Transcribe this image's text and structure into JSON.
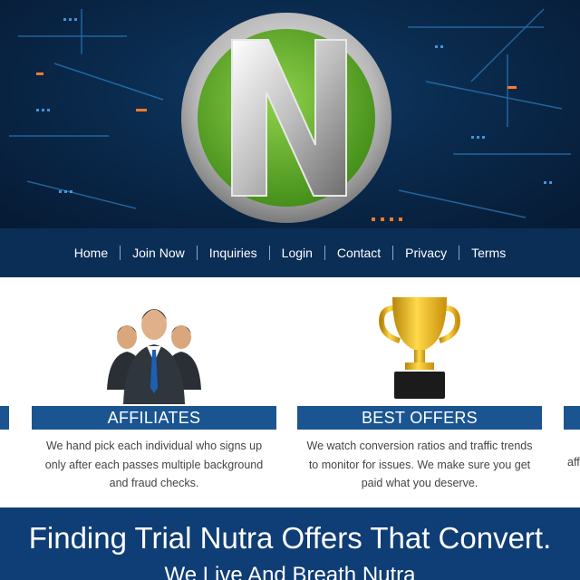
{
  "colors": {
    "header_bg": "#0a2a4d",
    "nav_bg": "#0b2e57",
    "ribbon": "#1a5591",
    "tagline_bg": "#0f3d75",
    "logo_green": "#6ab22e"
  },
  "logo": {
    "letter": "N",
    "icon": "nutra-n-logo"
  },
  "nav": {
    "items": [
      {
        "label": "Home"
      },
      {
        "label": "Join Now"
      },
      {
        "label": "Inquiries"
      },
      {
        "label": "Login"
      },
      {
        "label": "Contact"
      },
      {
        "label": "Privacy"
      },
      {
        "label": "Terms"
      }
    ]
  },
  "features": [
    {
      "title": "AFFILIATES",
      "icon": "business-team-icon",
      "lines": [
        "We hand pick each individual who signs up",
        "only after each passes multiple background",
        "and fraud checks."
      ]
    },
    {
      "title": "BEST OFFERS",
      "icon": "trophy-icon",
      "lines": [
        "We watch conversion ratios and traffic trends",
        "to monitor for issues. We make sure you get",
        "paid what you deserve."
      ]
    }
  ],
  "edge": {
    "right_text": "aff"
  },
  "tagline": {
    "headline": "Finding Trial Nutra Offers That Convert.",
    "subline": "We Live And Breath Nutra"
  }
}
